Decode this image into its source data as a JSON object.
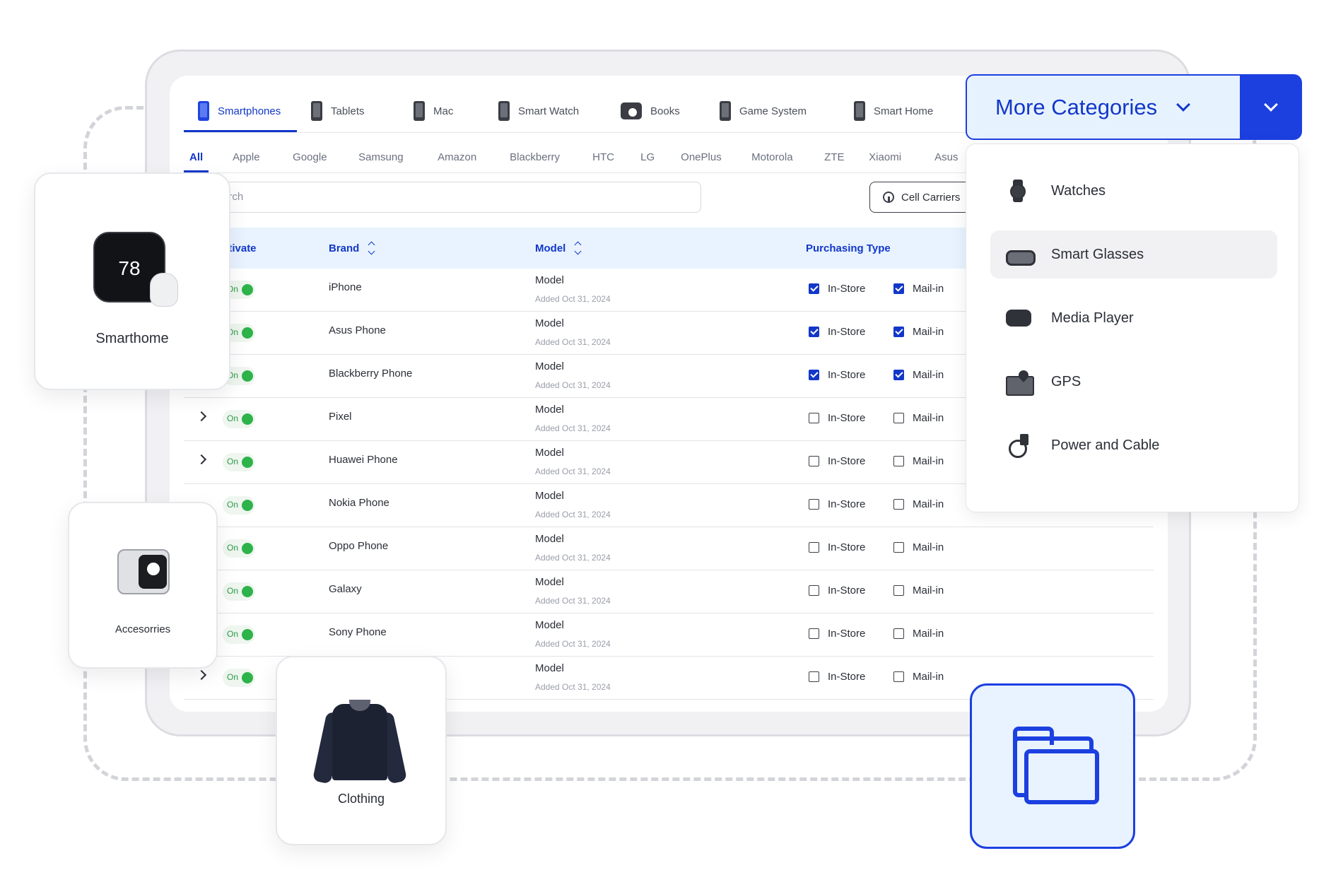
{
  "category_tabs": [
    {
      "label": "Smartphones",
      "icon": "smartphone-icon",
      "active": true
    },
    {
      "label": "Tablets",
      "icon": "tablet-icon"
    },
    {
      "label": "Mac",
      "icon": "mac-icon"
    },
    {
      "label": "Smart Watch",
      "icon": "smartwatch-icon"
    },
    {
      "label": "Books",
      "icon": "camera-icon"
    },
    {
      "label": "Game System",
      "icon": "game-system-icon"
    },
    {
      "label": "Smart Home",
      "icon": "smart-home-icon"
    }
  ],
  "brand_tabs": [
    "All",
    "Apple",
    "Google",
    "Samsung",
    "Amazon",
    "Blackberry",
    "HTC",
    "LG",
    "OnePlus",
    "Motorola",
    "ZTE",
    "Xiaomi",
    "Asus"
  ],
  "search": {
    "placeholder": "arch"
  },
  "cell_carriers_label": "Cell Carriers",
  "table": {
    "headers": {
      "activate": "ctivate",
      "brand": "Brand",
      "model": "Model",
      "purchasing": "Purchasing Type"
    },
    "rows": [
      {
        "toggle": "On",
        "brand": "iPhone",
        "model": "Model",
        "added": "Added Oct 31, 2024",
        "in_store": "In-Store",
        "mail_in": "Mail-in"
      },
      {
        "toggle": "On",
        "brand": "Asus Phone",
        "model": "Model",
        "added": "Added Oct 31, 2024",
        "in_store": "In-Store",
        "mail_in": "Mail-in"
      },
      {
        "toggle": "On",
        "brand": "Blackberry Phone",
        "model": "Model",
        "added": "Added Oct 31, 2024",
        "in_store": "In-Store",
        "mail_in": "Mail-in"
      },
      {
        "toggle": "On",
        "brand": "Pixel",
        "model": "Model",
        "added": "Added Oct 31, 2024",
        "in_store": "In-Store",
        "mail_in": "Mail-in"
      },
      {
        "toggle": "On",
        "brand": "Huawei Phone",
        "model": "Model",
        "added": "Added Oct 31, 2024",
        "in_store": "In-Store",
        "mail_in": "Mail-in"
      },
      {
        "toggle": "On",
        "brand": "Nokia Phone",
        "model": "Model",
        "added": "Added Oct 31, 2024",
        "in_store": "In-Store",
        "mail_in": "Mail-in"
      },
      {
        "toggle": "On",
        "brand": "Oppo Phone",
        "model": "Model",
        "added": "Added Oct 31, 2024",
        "in_store": "In-Store",
        "mail_in": "Mail-in"
      },
      {
        "toggle": "On",
        "brand": "Galaxy",
        "model": "Model",
        "added": "Added Oct 31, 2024",
        "in_store": "In-Store",
        "mail_in": "Mail-in"
      },
      {
        "toggle": "On",
        "brand": "Sony Phone",
        "model": "Model",
        "added": "Added Oct 31, 2024",
        "in_store": "In-Store",
        "mail_in": "Mail-in"
      },
      {
        "toggle": "On",
        "brand": "",
        "model": "Model",
        "added": "Added Oct 31, 2024",
        "in_store": "In-Store",
        "mail_in": "Mail-in"
      }
    ]
  },
  "more_categories": {
    "label": "More Categories",
    "items": [
      {
        "label": "Watches",
        "icon": "watch-icon"
      },
      {
        "label": "Smart Glasses",
        "icon": "smart-glasses-icon"
      },
      {
        "label": "Media Player",
        "icon": "media-player-icon"
      },
      {
        "label": "GPS",
        "icon": "gps-icon"
      },
      {
        "label": "Power and Cable",
        "icon": "power-cable-icon"
      }
    ]
  },
  "cards": {
    "smarthome": "Smarthome",
    "thermostat_value": "78",
    "accessories": "Accesorries",
    "clothing": "Clothing"
  },
  "colors": {
    "accent": "#1c3fe0",
    "accent_light": "#e8f3ff",
    "toggle_green": "#2db34a"
  }
}
